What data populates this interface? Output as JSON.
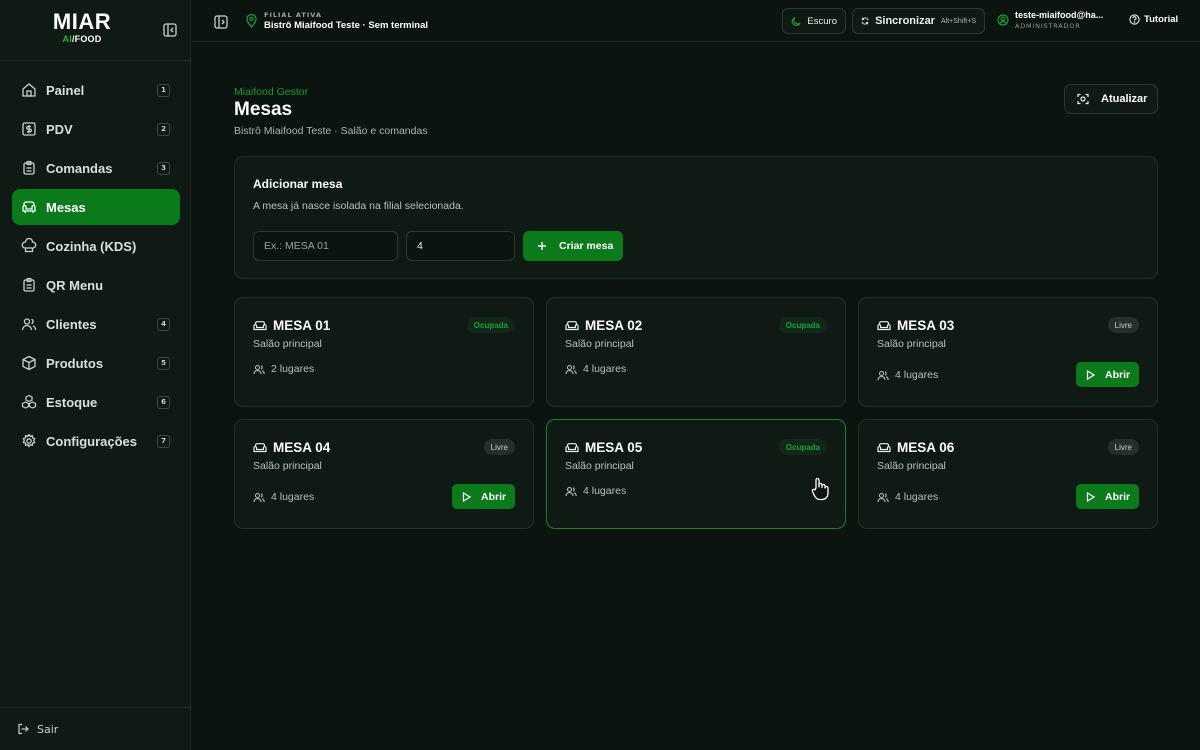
{
  "brand": {
    "title": "MIAR",
    "sub_accent": "AI",
    "sub_rest": "/FOOD"
  },
  "sidebar": {
    "items": [
      {
        "label": "Painel",
        "kbd": "1",
        "icon": "home-icon"
      },
      {
        "label": "PDV",
        "kbd": "2",
        "icon": "dollar-square-icon"
      },
      {
        "label": "Comandas",
        "kbd": "3",
        "icon": "clipboard-icon"
      },
      {
        "label": "Mesas",
        "kbd": "",
        "icon": "sofa-icon",
        "active": true
      },
      {
        "label": "Cozinha (KDS)",
        "kbd": "",
        "icon": "chef-hat-icon"
      },
      {
        "label": "QR Menu",
        "kbd": "",
        "icon": "clipboard-icon"
      },
      {
        "label": "Clientes",
        "kbd": "4",
        "icon": "users-icon"
      },
      {
        "label": "Produtos",
        "kbd": "5",
        "icon": "package-icon"
      },
      {
        "label": "Estoque",
        "kbd": "6",
        "icon": "boxes-icon"
      },
      {
        "label": "Configurações",
        "kbd": "7",
        "icon": "gear-icon"
      }
    ],
    "logout_label": "Sair"
  },
  "topbar": {
    "branch_kicker": "FILIAL ATIVA",
    "branch_name": "Bistrô Miaifood Teste · Sem terminal",
    "theme_label": "Escuro",
    "sync_label": "Sincronizar",
    "sync_shortcut": "Alt+Shift+S",
    "user_email": "teste-miaifood@ha...",
    "user_role": "ADMINISTRADOR",
    "tutorial_label": "Tutorial"
  },
  "page": {
    "kicker": "Miaifood Gestor",
    "title": "Mesas",
    "subtitle": "Bistrô Miaifood Teste · Salão e comandas",
    "refresh_label": "Atualizar"
  },
  "add_table": {
    "title": "Adicionar mesa",
    "description": "A mesa já nasce isolada na filial selecionada.",
    "name_placeholder": "Ex.: MESA 01",
    "seats_value": "4",
    "create_label": "Criar mesa"
  },
  "tables": [
    {
      "name": "MESA 01",
      "area": "Salão principal",
      "seats": "2 lugares",
      "status": "Ocupada"
    },
    {
      "name": "MESA 02",
      "area": "Salão principal",
      "seats": "4 lugares",
      "status": "Ocupada"
    },
    {
      "name": "MESA 03",
      "area": "Salão principal",
      "seats": "4 lugares",
      "status": "Livre",
      "action": "Abrir"
    },
    {
      "name": "MESA 04",
      "area": "Salão principal",
      "seats": "4 lugares",
      "status": "Livre",
      "action": "Abrir"
    },
    {
      "name": "MESA 05",
      "area": "Salão principal",
      "seats": "4 lugares",
      "status": "Ocupada"
    },
    {
      "name": "MESA 06",
      "area": "Salão principal",
      "seats": "4 lugares",
      "status": "Livre",
      "action": "Abrir"
    }
  ],
  "colors": {
    "accent": "#0a7a1a",
    "accent_text": "#1c9a32",
    "background": "#0b140f",
    "surface": "#0f1a14"
  }
}
